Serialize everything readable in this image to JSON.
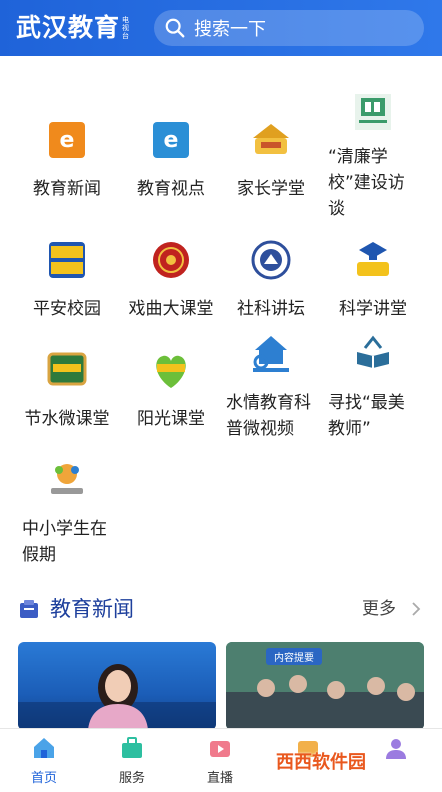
{
  "header": {
    "brand_main": "武汉教育",
    "brand_sub": "电视台",
    "search_placeholder": "搜索一下"
  },
  "grid": {
    "items": [
      {
        "label": "教育新闻",
        "icon": "education-news-icon",
        "color": "#f08a1c"
      },
      {
        "label": "教育视点",
        "icon": "education-viewpoint-icon",
        "color": "#2b8fd6"
      },
      {
        "label": "家长学堂",
        "icon": "parent-school-icon",
        "color": "#e0a020"
      },
      {
        "label": "“清廉学校”建设访谈",
        "icon": "clean-school-icon",
        "color": "#3b9b6b"
      },
      {
        "label": "平安校园",
        "icon": "safe-campus-icon",
        "color": "#f3c21c"
      },
      {
        "label": "戏曲大课堂",
        "icon": "opera-class-icon",
        "color": "#c0231f"
      },
      {
        "label": "社科讲坛",
        "icon": "social-science-forum-icon",
        "color": "#2e4f9c"
      },
      {
        "label": "科学讲堂",
        "icon": "science-lecture-icon",
        "color": "#1f56b0"
      },
      {
        "label": "节水微课堂",
        "icon": "water-saving-class-icon",
        "color": "#2e7a3c"
      },
      {
        "label": "阳光课堂",
        "icon": "sunshine-class-icon",
        "color": "#6cbf3a"
      },
      {
        "label": "水情教育科普微视频",
        "icon": "water-education-video-icon",
        "color": "#2d7fd1"
      },
      {
        "label": "寻找“最美教师”",
        "icon": "best-teacher-icon",
        "color": "#2b6e9a"
      },
      {
        "label": "中小学生在假期",
        "icon": "students-holiday-icon",
        "color": "#f0a53a"
      }
    ]
  },
  "section": {
    "title": "教育新闻",
    "more": "更多"
  },
  "news_cards": [
    {
      "tag": ""
    },
    {
      "tag": "内容提要"
    }
  ],
  "nav": {
    "items": [
      {
        "label": "首页",
        "icon": "home-icon"
      },
      {
        "label": "服务",
        "icon": "service-icon"
      },
      {
        "label": "直播",
        "icon": "live-icon"
      },
      {
        "label": "",
        "icon": "video-icon"
      },
      {
        "label": "",
        "icon": "profile-icon"
      }
    ]
  },
  "watermark": "西西软件园",
  "colors": {
    "header_blue": "#1f63d9",
    "active_nav": "#1f63d9",
    "section_title": "#1d3f9c"
  }
}
